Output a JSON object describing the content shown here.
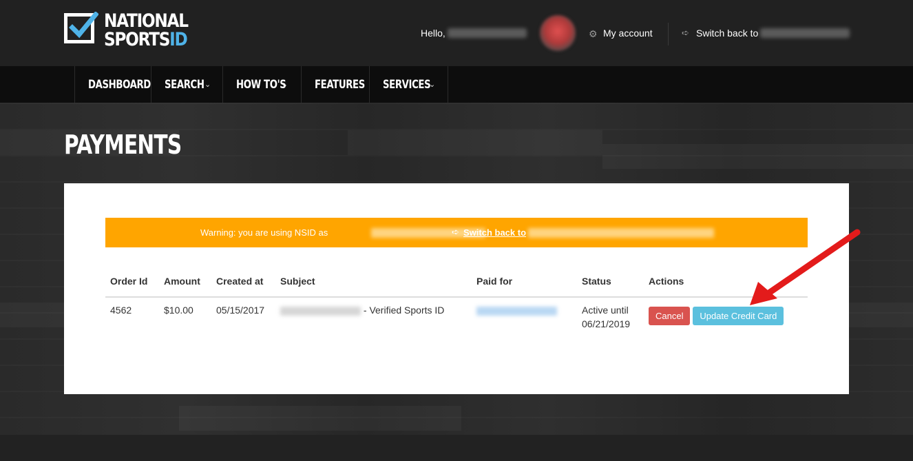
{
  "brand": {
    "word1": "NATIONAL",
    "word2a": "SPORTS",
    "word2b": "ID"
  },
  "header": {
    "hello": "Hello,",
    "my_account": "My account",
    "switch_back": "Switch back to"
  },
  "nav": {
    "items": [
      {
        "label": "DASHBOARD",
        "chevron": false
      },
      {
        "label": "SEARCH",
        "chevron": true
      },
      {
        "label": "HOW TO'S",
        "chevron": true
      },
      {
        "label": "FEATURES",
        "chevron": false
      },
      {
        "label": "SERVICES",
        "chevron": true
      }
    ],
    "chevron_glyph": "⌄"
  },
  "page": {
    "title": "PAYMENTS"
  },
  "warning": {
    "text": "Warning: you are using NSID as",
    "dot": ".",
    "link": "Switch back to"
  },
  "table": {
    "headers": [
      "Order Id",
      "Amount",
      "Created at",
      "Subject",
      "Paid for",
      "Status",
      "Actions"
    ],
    "rows": [
      {
        "order_id": "4562",
        "amount": "$10.00",
        "created_at": "05/15/2017",
        "subject_suffix": "- Verified Sports ID",
        "status_line1": "Active until",
        "status_line2": "06/21/2019",
        "cancel_label": "Cancel",
        "update_label": "Update Credit Card"
      }
    ]
  },
  "colors": {
    "warning": "#ffa500",
    "cancel": "#d9534f",
    "update": "#5bc0de",
    "brand_accent": "#4fb3e8",
    "arrow": "#e31b1b"
  }
}
